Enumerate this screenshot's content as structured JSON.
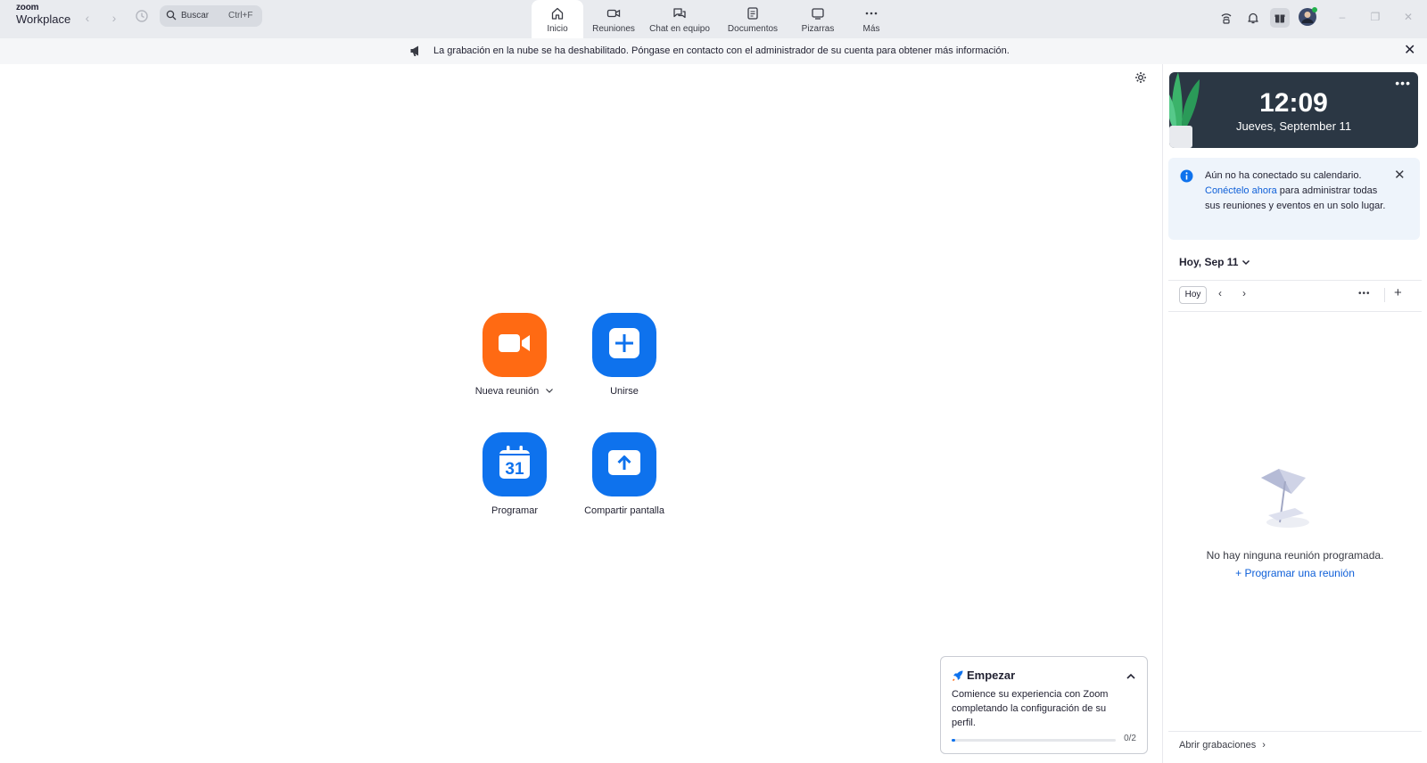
{
  "app": {
    "logo_top": "zoom",
    "logo_bottom": "Workplace"
  },
  "search": {
    "label": "Buscar",
    "shortcut": "Ctrl+F"
  },
  "tabs": [
    {
      "label": "Inicio",
      "icon": "home-icon",
      "active": true
    },
    {
      "label": "Reuniones",
      "icon": "video-icon"
    },
    {
      "label": "Chat en equipo",
      "icon": "chat-icon"
    },
    {
      "label": "Documentos",
      "icon": "document-icon"
    },
    {
      "label": "Pizarras",
      "icon": "whiteboard-icon"
    },
    {
      "label": "Más",
      "icon": "more-icon"
    }
  ],
  "banner": {
    "text": "La grabación en la nube se ha deshabilitado. Póngase en contacto con el administrador de su cuenta para obtener más información."
  },
  "actions": {
    "new_meeting": {
      "label": "Nueva reunión",
      "color": "#ff6a13"
    },
    "join": {
      "label": "Unirse",
      "color": "#0e72ed"
    },
    "schedule": {
      "label": "Programar",
      "color": "#0e72ed",
      "day": "31"
    },
    "share": {
      "label": "Compartir pantalla",
      "color": "#0e72ed"
    }
  },
  "clock": {
    "time": "12:09",
    "date": "Jueves, September 11"
  },
  "calendar_notice": {
    "line1": "Aún no ha conectado su calendario.",
    "link": "Conéctelo ahora",
    "rest": " para administrar todas sus reuniones y eventos en un solo lugar."
  },
  "calendar": {
    "day_selector": "Hoy, Sep 11",
    "today_button": "Hoy",
    "empty_text": "No hay ninguna reunión programada.",
    "schedule_link": "Programar una reunión",
    "open_recordings": "Abrir grabaciones"
  },
  "get_started": {
    "title": "Empezar",
    "text": "Comience su experiencia con Zoom completando la configuración de su perfil.",
    "progress": "0/2",
    "progress_fraction": 0.01
  }
}
